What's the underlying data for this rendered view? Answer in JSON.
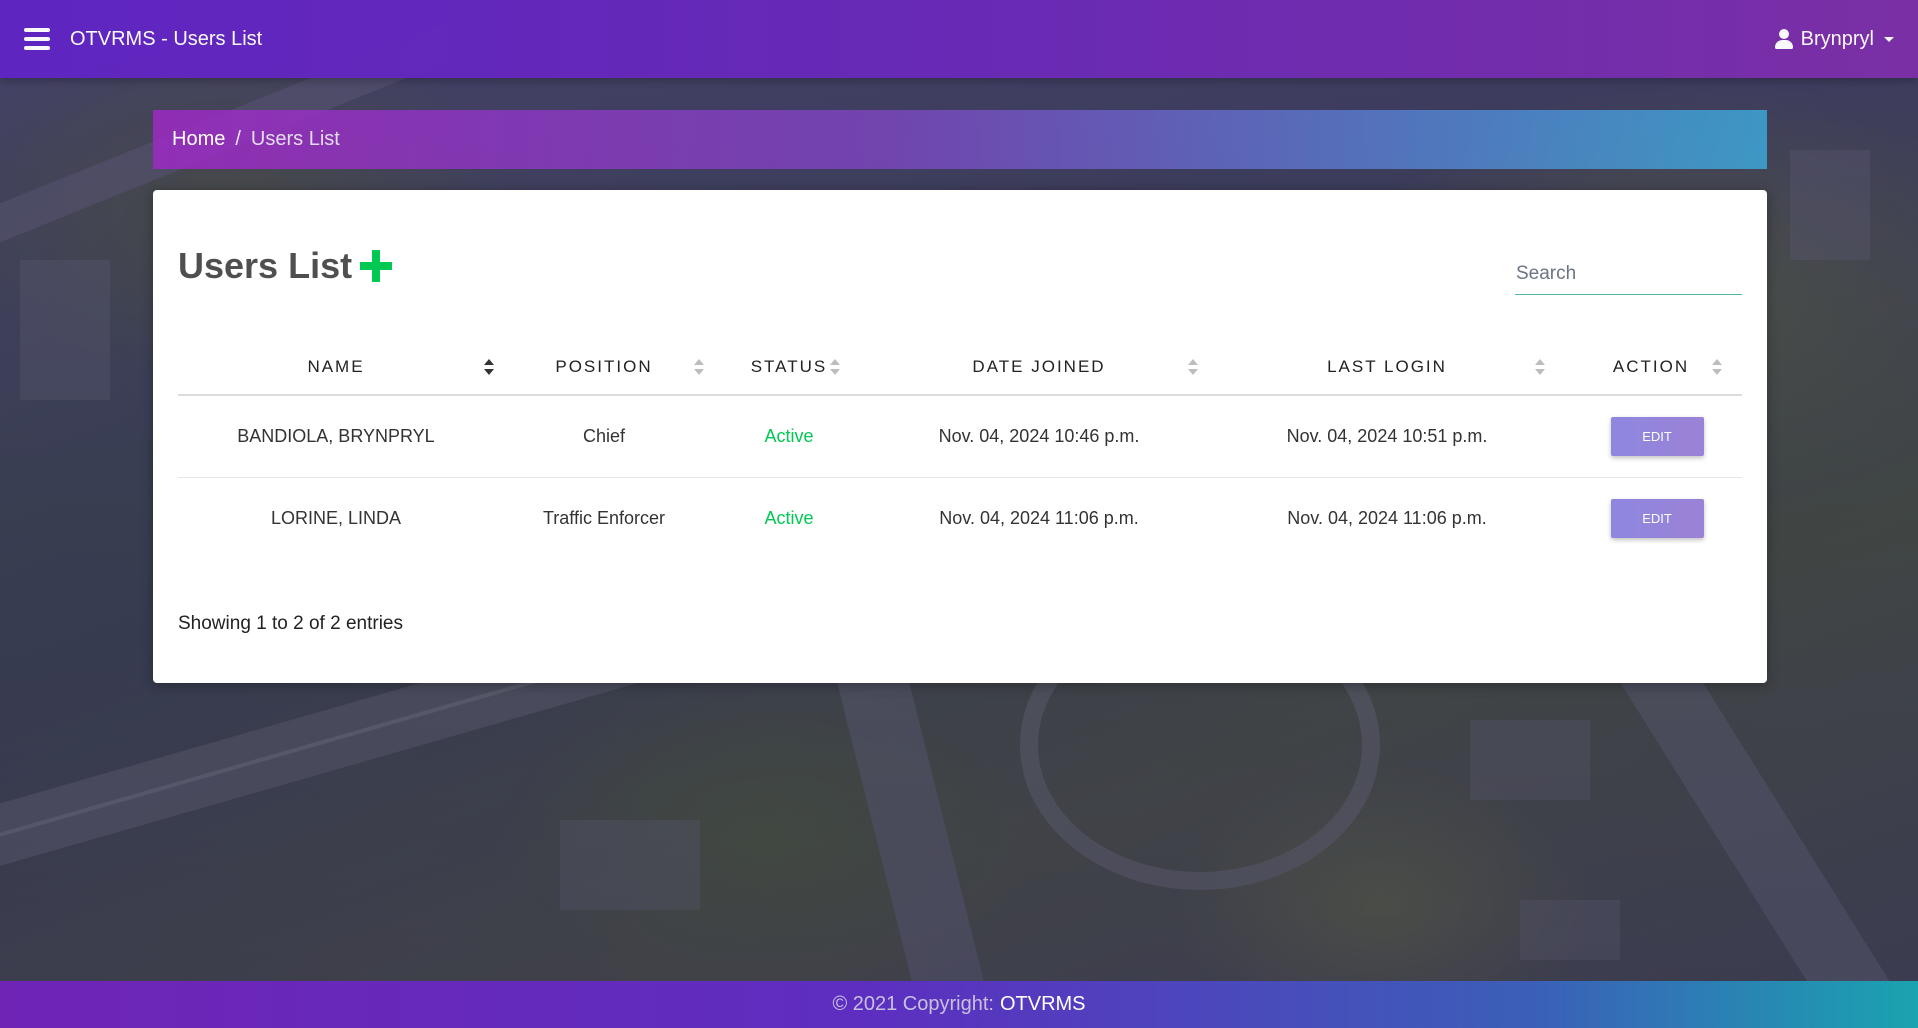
{
  "navbar": {
    "title": "OTVRMS - Users List",
    "user_name": "Brynpryl"
  },
  "breadcrumb": {
    "home": "Home",
    "separator": "/",
    "current": "Users List"
  },
  "card": {
    "title": "Users List",
    "search_placeholder": "Search"
  },
  "table": {
    "columns": [
      "NAME",
      "POSITION",
      "STATUS",
      "DATE JOINED",
      "LAST LOGIN",
      "ACTION"
    ],
    "sorted_column": "NAME",
    "rows": [
      {
        "name": "BANDIOLA, BRYNPRYL",
        "position": "Chief",
        "status": "Active",
        "date_joined": "Nov. 04, 2024 10:46 p.m.",
        "last_login": "Nov. 04, 2024 10:51 p.m.",
        "action": "EDIT"
      },
      {
        "name": "LORINE, LINDA",
        "position": "Traffic Enforcer",
        "status": "Active",
        "date_joined": "Nov. 04, 2024 11:06 p.m.",
        "last_login": "Nov. 04, 2024 11:06 p.m.",
        "action": "EDIT"
      }
    ],
    "entries_info": "Showing 1 to 2 of 2 entries"
  },
  "footer": {
    "copyright": "© 2021 Copyright:",
    "brand": "OTVRMS"
  },
  "colors": {
    "navbar": "#6a2ab8",
    "active_status": "#00c853",
    "add_icon": "#00c853",
    "edit_button": "#8e87e0"
  }
}
